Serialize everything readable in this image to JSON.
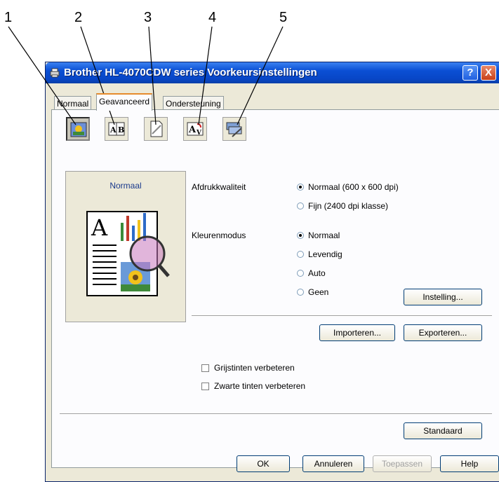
{
  "callouts": [
    "1",
    "2",
    "3",
    "4",
    "5"
  ],
  "window": {
    "title": "Brother HL-4070CDW series Voorkeursinstellingen",
    "help_glyph": "?",
    "close_glyph": "X"
  },
  "tabs": [
    "Normaal",
    "Geavanceerd",
    "Ondersteuning"
  ],
  "toolbar": {
    "icons": [
      "color-quality-icon",
      "duplex-icon",
      "watermark-icon",
      "page-setting-icon",
      "device-options-icon"
    ]
  },
  "preview": {
    "title": "Normaal"
  },
  "quality": {
    "label": "Afdrukkwaliteit",
    "options": [
      "Normaal (600 x 600 dpi)",
      "Fijn (2400 dpi klasse)"
    ],
    "selected": 0
  },
  "color_mode": {
    "label": "Kleurenmodus",
    "options": [
      "Normaal",
      "Levendig",
      "Auto",
      "Geen"
    ],
    "selected": 0
  },
  "buttons": {
    "setting": "Instelling...",
    "import": "Importeren...",
    "export": "Exporteren...",
    "default": "Standaard",
    "ok": "OK",
    "cancel": "Annuleren",
    "apply": "Toepassen",
    "help": "Help"
  },
  "checkboxes": {
    "gray": "Grijstinten verbeteren",
    "black": "Zwarte tinten verbeteren"
  }
}
